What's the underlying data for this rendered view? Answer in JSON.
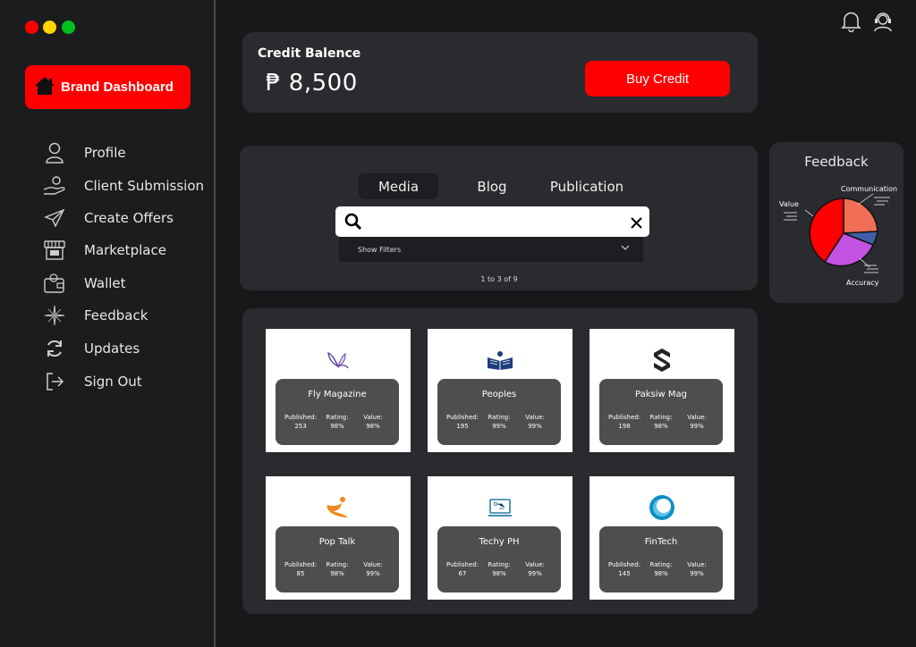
{
  "window": {
    "dots": [
      "#ff0000",
      "#ffd400",
      "#00c020"
    ]
  },
  "sidebar": {
    "brand_button": {
      "label": "Brand Dashboard",
      "icon": "home-icon"
    },
    "items": [
      {
        "label": "Profile",
        "icon": "user-icon"
      },
      {
        "label": "Client Submission",
        "icon": "hand-user-icon"
      },
      {
        "label": "Create Offers",
        "icon": "paper-plane-icon"
      },
      {
        "label": "Marketplace",
        "icon": "store-icon"
      },
      {
        "label": "Wallet",
        "icon": "wallet-icon"
      },
      {
        "label": "Feedback",
        "icon": "sparkle-icon"
      },
      {
        "label": "Updates",
        "icon": "refresh-icon"
      },
      {
        "label": "Sign Out",
        "icon": "sign-out-icon"
      }
    ]
  },
  "header": {
    "icons": [
      "bell-icon",
      "support-agent-icon"
    ]
  },
  "credit": {
    "title": "Credit Balence",
    "amount": "₱ 8,500",
    "buy_label": "Buy Credit"
  },
  "search": {
    "tabs": [
      {
        "label": "Media",
        "active": true
      },
      {
        "label": "Blog",
        "active": false
      },
      {
        "label": "Publication",
        "active": false
      }
    ],
    "value": "",
    "filters_label": "Show Filters",
    "page_count": "1 to 3 of 9"
  },
  "publications": [
    {
      "name": "Fly Magazine",
      "published": "253",
      "rating": "98%",
      "value": "98%",
      "logo": "butterfly-logo"
    },
    {
      "name": "Peoples",
      "published": "195",
      "rating": "99%",
      "value": "99%",
      "logo": "book-reader-logo"
    },
    {
      "name": "Paksiw Mag",
      "published": "198",
      "rating": "98%",
      "value": "99%",
      "logo": "s-shape-logo"
    },
    {
      "name": "Pop Talk",
      "published": "85",
      "rating": "98%",
      "value": "99%",
      "logo": "swoosh-person-logo"
    },
    {
      "name": "Techy PH",
      "published": "67",
      "rating": "98%",
      "value": "99%",
      "logo": "monitor-circuit-logo"
    },
    {
      "name": "FinTech",
      "published": "145",
      "rating": "98%",
      "value": "99%",
      "logo": "ring-logo"
    }
  ],
  "stat_labels": {
    "published": "Published:",
    "rating": "Rating:",
    "value": "Value:"
  },
  "feedback": {
    "title": "Feedback",
    "labels": {
      "communication": "Communication",
      "value": "Value",
      "accuracy": "Accuracy"
    },
    "colors": {
      "communication": "#ef6e55",
      "blue": "#3f5ea8",
      "accuracy": "#c452e0",
      "value": "#ff0000"
    }
  }
}
